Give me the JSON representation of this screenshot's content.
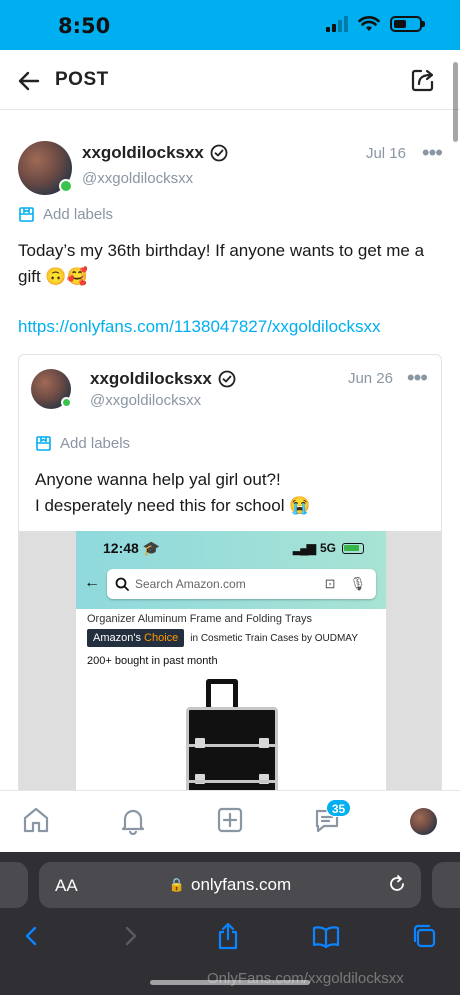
{
  "status_bar": {
    "time": "8:50"
  },
  "header": {
    "title": "POST"
  },
  "post": {
    "display_name": "xxgoldilocksxx",
    "handle": "@xxgoldilocksxx",
    "date": "Jul 16",
    "labels_text": "Add labels",
    "text": "Today’s my 36th birthday! If anyone wants to get me a gift 🙃🥰",
    "link": "https://onlyfans.com/1138047827/xxgoldilocksxx"
  },
  "quoted_post": {
    "display_name": "xxgoldilocksxx",
    "handle": "@xxgoldilocksxx",
    "date": "Jun 26",
    "labels_text": "Add labels",
    "text_line1": "Anyone wanna help yal girl out?!",
    "text_line2": "I desperately need this for school 😭",
    "media": {
      "time": "12:48",
      "network": "5G",
      "search_placeholder": "Search Amazon.com",
      "title_line": "Organizer Aluminum Frame and Folding Trays",
      "badge_prefix": "Amazon's",
      "badge_highlight": "Choice",
      "badge_category": "in Cosmetic Train Cases by OUDMAY",
      "bought_text": "200+ bought in past month"
    }
  },
  "bottom_nav": {
    "messages_badge": "35"
  },
  "browser": {
    "aa_label": "AA",
    "url": "onlyfans.com",
    "watermark": "OnlyFans.com/xxgoldilocksxx"
  },
  "colors": {
    "accent": "#00aff0",
    "online": "#3ac34b",
    "muted": "#8a96a3"
  }
}
